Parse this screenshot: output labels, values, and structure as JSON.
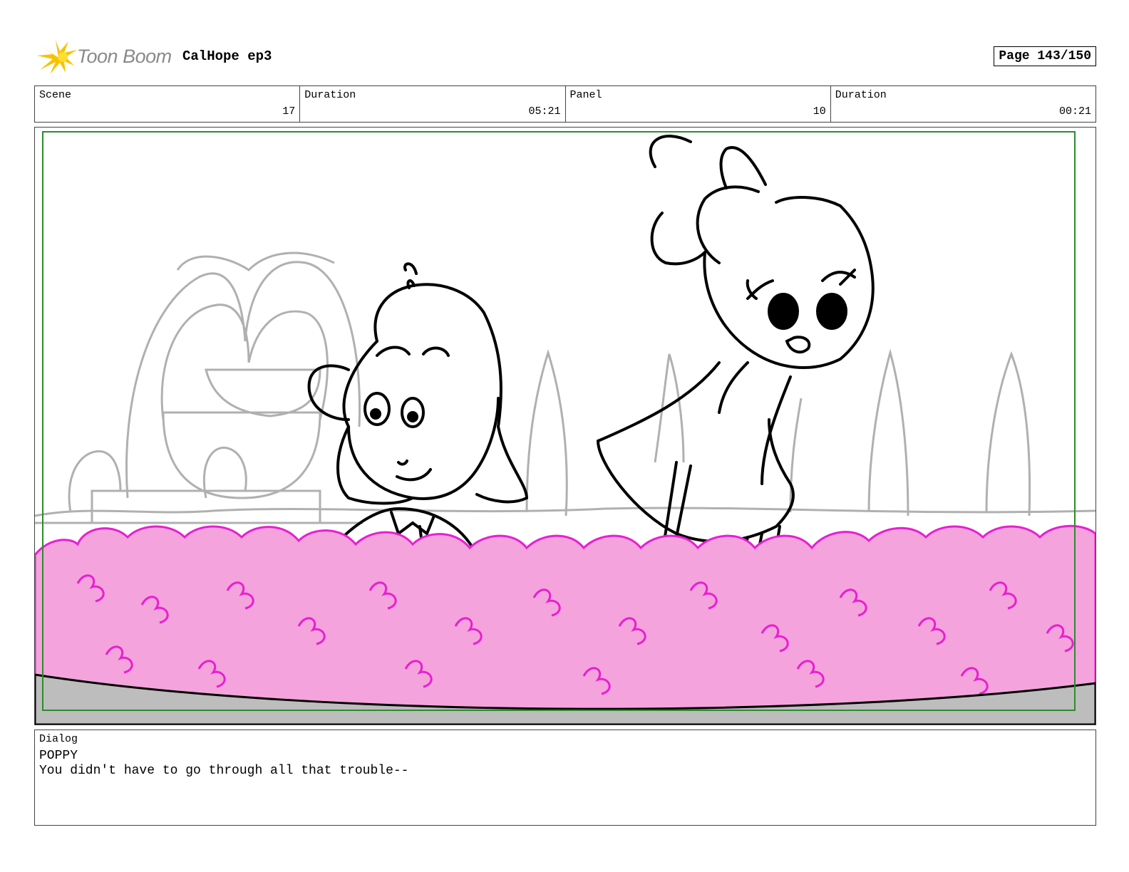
{
  "header": {
    "logo_text": "Toon Boom",
    "project_title": "CalHope ep3",
    "page_label": "Page 143/150"
  },
  "info": {
    "scene_label": "Scene",
    "scene_value": "17",
    "duration_label": "Duration",
    "scene_duration": "05:21",
    "panel_label": "Panel",
    "panel_value": "10",
    "panel_duration_label": "Duration",
    "panel_duration": "00:21"
  },
  "dialog": {
    "label": "Dialog",
    "speaker": "POPPY",
    "line": "You didn't have to go through all that trouble--"
  },
  "colors": {
    "bush_fill": "#f4a3dc",
    "bush_line": "#e81fd0",
    "safe_frame": "#2e8b2e",
    "sketch_gray": "#b0b0b0"
  }
}
